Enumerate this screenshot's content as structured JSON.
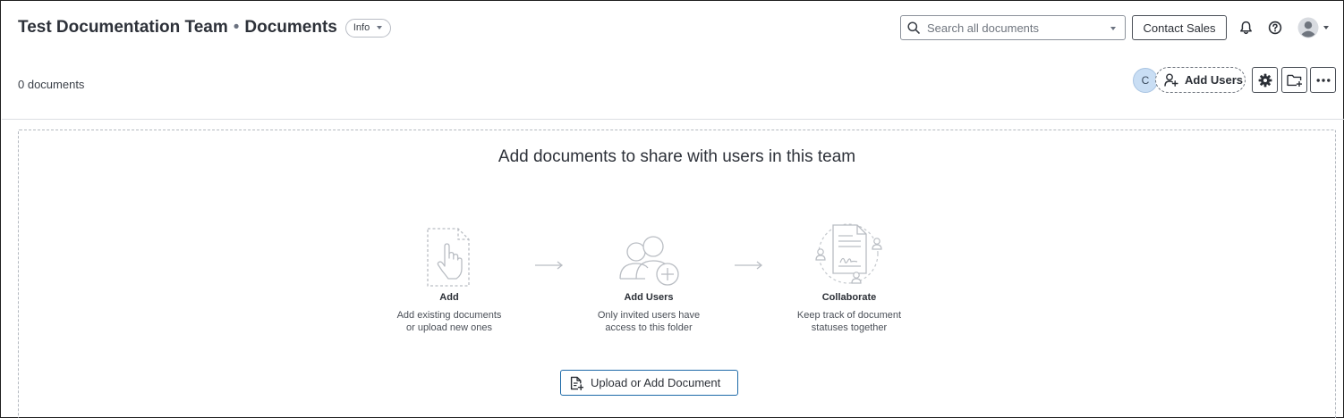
{
  "header": {
    "team_name": "Test Documentation Team",
    "separator": "•",
    "page_name": "Documents",
    "info_label": "Info",
    "search_placeholder": "Search all documents",
    "contact_sales_label": "Contact Sales",
    "icons": [
      "bell-icon",
      "help-icon",
      "user-avatar-icon"
    ]
  },
  "toolbar": {
    "document_count": "0 documents",
    "member_initial": "C",
    "add_users_label": "Add Users",
    "icons": [
      "gear-icon",
      "new-folder-icon",
      "more-icon"
    ]
  },
  "empty_state": {
    "title": "Add documents to share with users in this team",
    "steps": [
      {
        "title": "Add",
        "desc_line1": "Add existing documents",
        "desc_line2": "or upload new ones"
      },
      {
        "title": "Add Users",
        "desc_line1": "Only invited users have",
        "desc_line2": "access to this folder"
      },
      {
        "title": "Collaborate",
        "desc_line1": "Keep track of document",
        "desc_line2": "statuses together"
      }
    ],
    "upload_label": "Upload or Add Document"
  },
  "colors": {
    "text": "#2b2f36",
    "accent_border": "#1e6aa8",
    "avatar_chip": "#c9def4",
    "illustration": "#b9bdc3"
  }
}
